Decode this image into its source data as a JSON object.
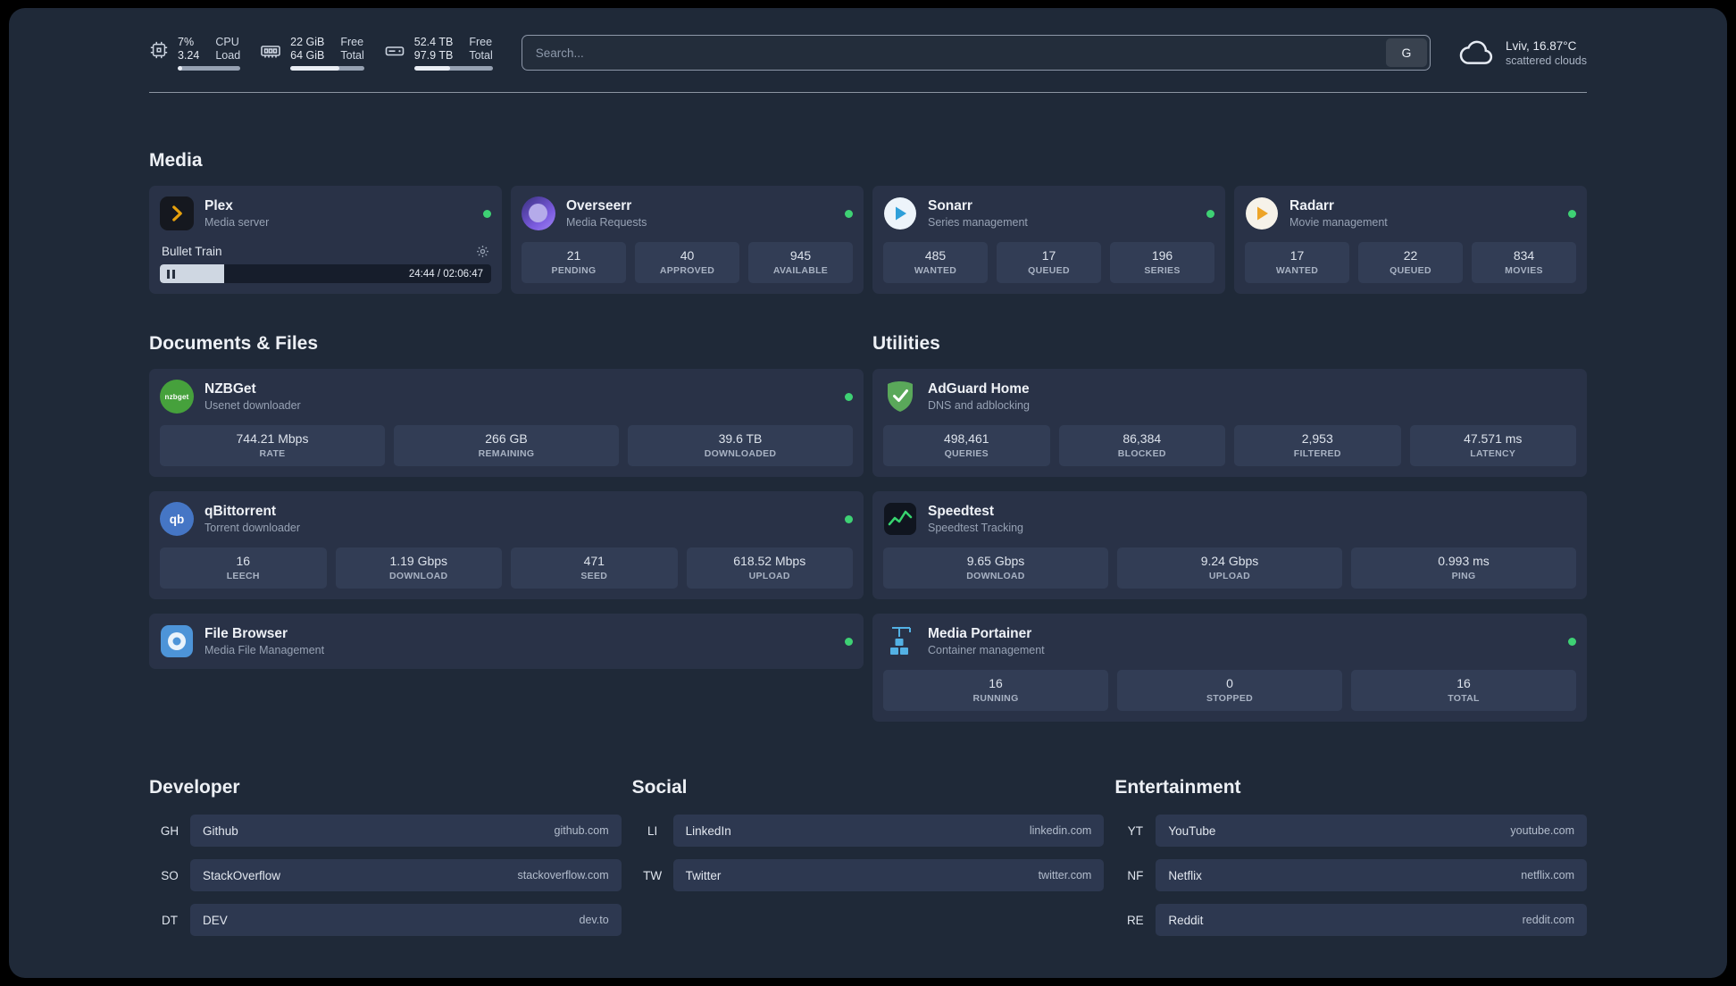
{
  "topbar": {
    "cpu": {
      "value1": "7%",
      "label1": "CPU",
      "value2": "3.24",
      "label2": "Load",
      "bar_percent": 7
    },
    "memory": {
      "value1": "22 GiB",
      "label1": "Free",
      "value2": "64 GiB",
      "label2": "Total",
      "bar_percent": 66
    },
    "disk": {
      "value1": "52.4 TB",
      "label1": "Free",
      "value2": "97.9 TB",
      "label2": "Total",
      "bar_percent": 46
    },
    "search": {
      "placeholder": "Search...",
      "provider_label": "G"
    },
    "weather": {
      "location": "Lviv, 16.87°C",
      "condition": "scattered clouds"
    }
  },
  "sections": {
    "media": {
      "title": "Media",
      "plex": {
        "name": "Plex",
        "subtitle": "Media server",
        "now_playing": "Bullet Train",
        "progress_percent": 19.5,
        "time": "24:44 / 02:06:47"
      },
      "overseerr": {
        "name": "Overseerr",
        "subtitle": "Media Requests",
        "stats": [
          {
            "value": "21",
            "label": "PENDING"
          },
          {
            "value": "40",
            "label": "APPROVED"
          },
          {
            "value": "945",
            "label": "AVAILABLE"
          }
        ]
      },
      "sonarr": {
        "name": "Sonarr",
        "subtitle": "Series management",
        "stats": [
          {
            "value": "485",
            "label": "WANTED"
          },
          {
            "value": "17",
            "label": "QUEUED"
          },
          {
            "value": "196",
            "label": "SERIES"
          }
        ]
      },
      "radarr": {
        "name": "Radarr",
        "subtitle": "Movie management",
        "stats": [
          {
            "value": "17",
            "label": "WANTED"
          },
          {
            "value": "22",
            "label": "QUEUED"
          },
          {
            "value": "834",
            "label": "MOVIES"
          }
        ]
      }
    },
    "documents": {
      "title": "Documents & Files",
      "nzbget": {
        "name": "NZBGet",
        "subtitle": "Usenet downloader",
        "icon_label": "nzbget",
        "stats": [
          {
            "value": "744.21 Mbps",
            "label": "RATE"
          },
          {
            "value": "266 GB",
            "label": "REMAINING"
          },
          {
            "value": "39.6 TB",
            "label": "DOWNLOADED"
          }
        ]
      },
      "qbittorrent": {
        "name": "qBittorrent",
        "subtitle": "Torrent downloader",
        "icon_label": "qb",
        "stats": [
          {
            "value": "16",
            "label": "LEECH"
          },
          {
            "value": "1.19 Gbps",
            "label": "DOWNLOAD"
          },
          {
            "value": "471",
            "label": "SEED"
          },
          {
            "value": "618.52 Mbps",
            "label": "UPLOAD"
          }
        ]
      },
      "filebrowser": {
        "name": "File Browser",
        "subtitle": "Media File Management"
      }
    },
    "utilities": {
      "title": "Utilities",
      "adguard": {
        "name": "AdGuard Home",
        "subtitle": "DNS and adblocking",
        "stats": [
          {
            "value": "498,461",
            "label": "QUERIES"
          },
          {
            "value": "86,384",
            "label": "BLOCKED"
          },
          {
            "value": "2,953",
            "label": "FILTERED"
          },
          {
            "value": "47.571 ms",
            "label": "LATENCY"
          }
        ]
      },
      "speedtest": {
        "name": "Speedtest",
        "subtitle": "Speedtest Tracking",
        "stats": [
          {
            "value": "9.65 Gbps",
            "label": "DOWNLOAD"
          },
          {
            "value": "9.24 Gbps",
            "label": "UPLOAD"
          },
          {
            "value": "0.993 ms",
            "label": "PING"
          }
        ]
      },
      "portainer": {
        "name": "Media Portainer",
        "subtitle": "Container management",
        "stats": [
          {
            "value": "16",
            "label": "RUNNING"
          },
          {
            "value": "0",
            "label": "STOPPED"
          },
          {
            "value": "16",
            "label": "TOTAL"
          }
        ]
      }
    }
  },
  "bookmarks": [
    {
      "title": "Developer",
      "items": [
        {
          "abbr": "GH",
          "name": "Github",
          "url": "github.com"
        },
        {
          "abbr": "SO",
          "name": "StackOverflow",
          "url": "stackoverflow.com"
        },
        {
          "abbr": "DT",
          "name": "DEV",
          "url": "dev.to"
        }
      ]
    },
    {
      "title": "Social",
      "items": [
        {
          "abbr": "LI",
          "name": "LinkedIn",
          "url": "linkedin.com"
        },
        {
          "abbr": "TW",
          "name": "Twitter",
          "url": "twitter.com"
        }
      ]
    },
    {
      "title": "Entertainment",
      "items": [
        {
          "abbr": "YT",
          "name": "YouTube",
          "url": "youtube.com"
        },
        {
          "abbr": "NF",
          "name": "Netflix",
          "url": "netflix.com"
        },
        {
          "abbr": "RE",
          "name": "Reddit",
          "url": "reddit.com"
        }
      ]
    }
  ],
  "colors": {
    "status_online": "#3ed174",
    "accent_plex": "#e5a00d",
    "page_background": "#1f2938",
    "card_background": "#293247",
    "tile_background": "#323d55"
  }
}
